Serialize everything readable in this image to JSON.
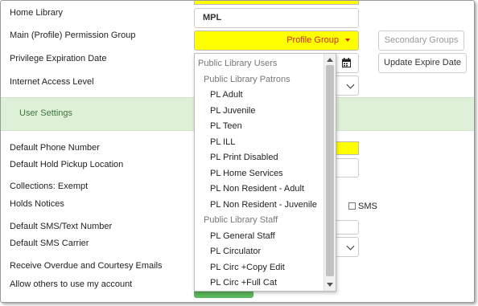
{
  "form": {
    "home_library_label": "Home Library",
    "home_library_value": "MPL",
    "profile_group_label": "Main (Profile) Permission Group",
    "profile_group_value": "Profile Group",
    "secondary_groups_label": "Secondary Groups",
    "privilege_expiration_label": "Privilege Expiration Date",
    "update_expire_label": "Update Expire Date",
    "internet_access_label": "Internet Access Level",
    "user_settings_label": "User Settings",
    "default_phone_label": "Default Phone Number",
    "default_hold_pickup_label": "Default Hold Pickup Location",
    "collections_exempt_label": "Collections: Exempt",
    "holds_notices_label": "Holds Notices",
    "sms_label": "SMS",
    "default_sms_number_label": "Default SMS/Text Number",
    "default_sms_carrier_label": "Default SMS Carrier",
    "receive_overdue_label": "Receive Overdue and Courtesy Emails",
    "allow_others_label": "Allow others to use my account"
  },
  "dropdown": {
    "groups": [
      {
        "label": "Public Library Users",
        "level": 0
      },
      {
        "label": "Public Library Patrons",
        "level": 1
      },
      {
        "label": "PL Adult",
        "level": 2
      },
      {
        "label": "PL Juvenile",
        "level": 2
      },
      {
        "label": "PL Teen",
        "level": 2
      },
      {
        "label": "PL ILL",
        "level": 2
      },
      {
        "label": "PL Print Disabled",
        "level": 2
      },
      {
        "label": "PL Home Services",
        "level": 2
      },
      {
        "label": "PL Non Resident - Adult",
        "level": 2
      },
      {
        "label": "PL Non Resident - Juvenile",
        "level": 2
      },
      {
        "label": "Public Library Staff",
        "level": 1
      },
      {
        "label": "PL General Staff",
        "level": 2
      },
      {
        "label": "PL Circulator",
        "level": 2
      },
      {
        "label": "PL Circ +Copy Edit",
        "level": 2
      },
      {
        "label": "PL Circ +Full Cat",
        "level": 2
      }
    ]
  },
  "colors": {
    "profile_bg": "#ffff00",
    "profile_text": "#d9241c",
    "settings_band": "#dff0d8",
    "settings_text": "#3c763d",
    "save_button": "#5cb85c"
  },
  "icons": [
    "calendar-icon",
    "chevron-down-icon",
    "caret-down-icon"
  ]
}
